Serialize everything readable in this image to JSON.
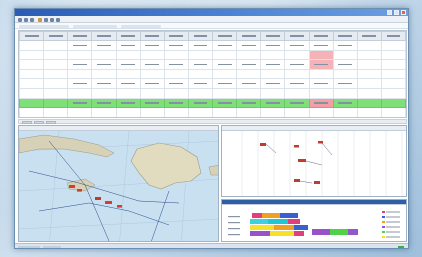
{
  "table": {
    "rows": [
      0,
      1,
      2,
      3,
      4,
      5,
      6,
      7
    ],
    "highlighted_row": 6,
    "columns": 16
  }
}
